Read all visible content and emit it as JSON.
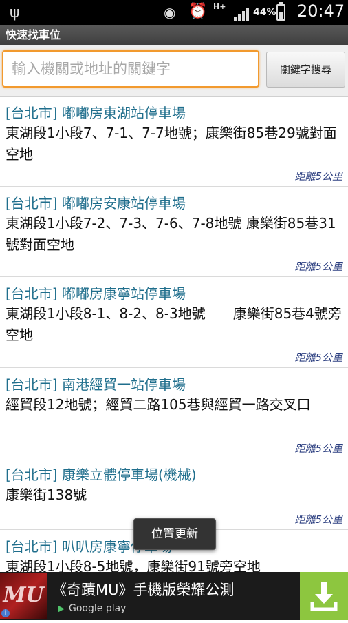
{
  "status_bar": {
    "network": "H+",
    "battery": "44%",
    "time": "20:47"
  },
  "app": {
    "title": "快速找車位"
  },
  "search": {
    "placeholder": "輸入機關或地址的關鍵字",
    "button_label": "關鍵字搜尋"
  },
  "results": [
    {
      "title": "[台北市] 嘟嘟房東湖站停車場",
      "address": "東湖段1小段7、7-1、7-7地號；康樂街85巷29號對面空地",
      "distance": "距離5公里"
    },
    {
      "title": "[台北市] 嘟嘟房安康站停車場",
      "address": "東湖段1小段7-2、7-3、7-6、7-8地號 康樂街85巷31號對面空地",
      "distance": "距離5公里"
    },
    {
      "title": "[台北市] 嘟嘟房康寧站停車場",
      "address": "東湖段1小段8-1、8-2、8-3地號　　康樂街85巷4號旁空地",
      "distance": "距離5公里"
    },
    {
      "title": "[台北市] 南港經貿一站停車場",
      "address": "經貿段12地號；經貿二路105巷與經貿一路交叉口",
      "distance": "距離5公里"
    },
    {
      "title": "[台北市] 康樂立體停車場(機械)",
      "address": "康樂街138號",
      "distance": "距離5公里"
    },
    {
      "title": "[台北市] 叭叭房康寧停車場",
      "address": "東湖段1小段8-5地號，康樂街91號旁空地",
      "distance": ""
    }
  ],
  "toast": {
    "text": "位置更新"
  },
  "ad": {
    "logo_text": "MU",
    "headline": "《奇蹟MU》手機版榮耀公測",
    "store": "Google play",
    "accent_color": "#8dc63f"
  },
  "colors": {
    "title_text": "#1f6e8c",
    "distance_text": "#2c3f80",
    "search_border": "#f29a2e"
  }
}
